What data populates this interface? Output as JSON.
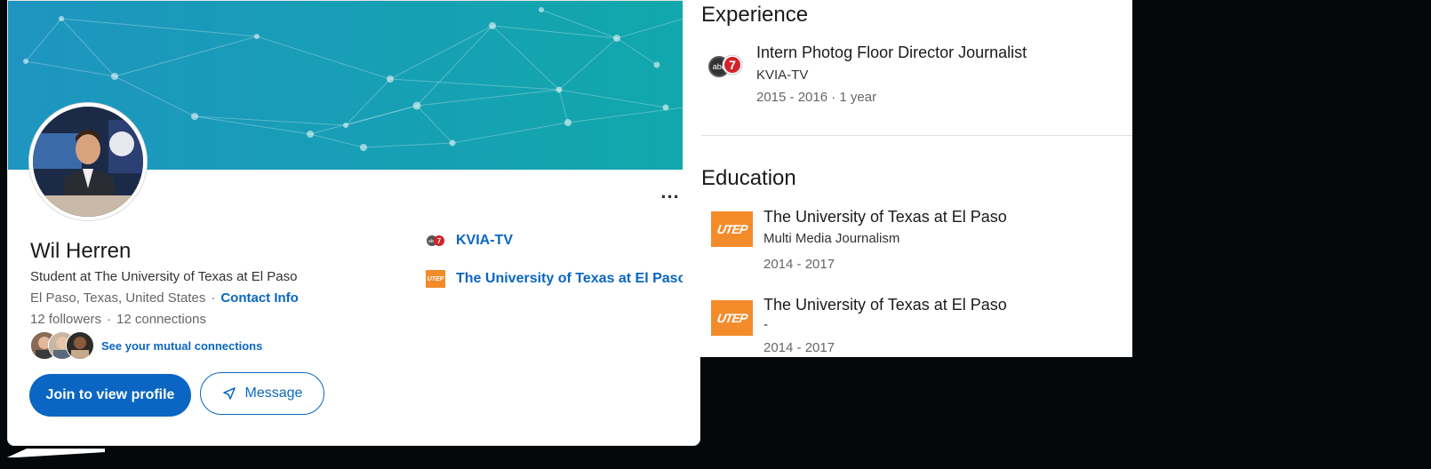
{
  "profile": {
    "name": "Wil Herren",
    "headline": "Student at The University of Texas at El Paso",
    "location": "El Paso, Texas, United States",
    "contact_label": "Contact Info",
    "followers": "12 followers",
    "connections": "12 connections",
    "mutual_label": "See your mutual connections",
    "more_label": "...",
    "join_label": "Join to view profile",
    "message_label": "Message",
    "links": [
      {
        "label": "KVIA-TV",
        "icon": "abc7-logo-icon"
      },
      {
        "label": "The University of Texas at El Paso",
        "icon": "utep-logo-icon"
      }
    ]
  },
  "experience": {
    "title": "Experience",
    "items": [
      {
        "role": "Intern Photog Floor Director Journalist",
        "company": "KVIA-TV",
        "dates": "2015 - 2016",
        "duration": "· 1 year"
      }
    ]
  },
  "education": {
    "title": "Education",
    "items": [
      {
        "school": "The University of Texas at El Paso",
        "field": "Multi Media Journalism",
        "dates": "2014 - 2017"
      },
      {
        "school": "The University of Texas at El Paso",
        "field": "-",
        "dates": "2014 - 2017"
      }
    ]
  },
  "logos": {
    "utep_text": "UTEP",
    "abc_text": "abc",
    "abc_num": "7"
  },
  "colors": {
    "accent": "#0a66c2",
    "cover_start": "#1e9bc0",
    "cover_end": "#0fa7a8",
    "utep_orange": "#f38b2b",
    "outer_bg": "#04080a"
  }
}
